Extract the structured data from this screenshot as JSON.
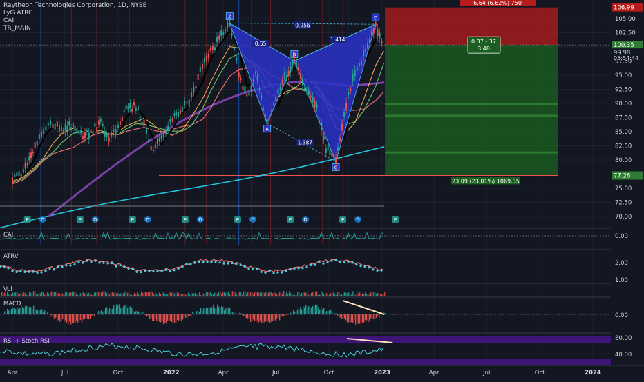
{
  "header": {
    "symbol_line": "Raytheon Technologies Corporation, 1D, NYSE",
    "indicators": [
      "LyG ATRC",
      "CAI",
      "TR_MAIN"
    ]
  },
  "panes": {
    "cai": "CAI",
    "atrv": "ATRV",
    "vol": "Vol",
    "macd": "MACD",
    "rsi": "RSI + Stoch RSI"
  },
  "colors": {
    "background": "#131722",
    "up": "#26a69a",
    "down": "#ef5350",
    "harmonic_fill": "#2a32c8",
    "ema_cyan": "#26c6da",
    "ema_purple": "#7b3fa8",
    "stop_zone": "#b71c1c",
    "target_zone": "#1b5e20"
  },
  "chart_data": {
    "type": "line",
    "title": "Raytheon Technologies Corporation, 1D, NYSE",
    "ylim": [
      68,
      107.5
    ],
    "price_axis_ticks": [
      "105.00",
      "102.50",
      "100.35",
      "97.50",
      "95.00",
      "92.50",
      "90.00",
      "87.50",
      "85.00",
      "82.50",
      "80.00",
      "77.50",
      "75.00",
      "72.50",
      "70.00"
    ],
    "time_axis_labels": [
      "Apr",
      "Jul",
      "Oct",
      "2022",
      "Apr",
      "Jul",
      "Oct",
      "2023",
      "Apr",
      "Jul",
      "Oct",
      "2024"
    ],
    "badges": {
      "top_red": "106.99",
      "entry": "100.35",
      "last": "99.98",
      "countdown": "05:54:44",
      "bottom": "77.26"
    },
    "position": {
      "entry": 100.35,
      "stop": 106.99,
      "target": 77.26,
      "stop_label": "6.64 (6.62%) 750",
      "target_label": "23.09 (23.01%) 1869.35",
      "rr_line1": "0.37 - 37",
      "rr_line2": "3.48"
    },
    "harmonic_points": [
      {
        "label": "X",
        "date": "2022-04-12",
        "price": 104.2
      },
      {
        "label": "A",
        "date": "2022-06-16",
        "price": 86.5
      },
      {
        "label": "B",
        "date": "2022-08-02",
        "price": 97.5
      },
      {
        "label": "C",
        "date": "2022-10-13",
        "price": 79.7
      },
      {
        "label": "D",
        "date": "2022-12-21",
        "price": 104.0
      }
    ],
    "harmonic_ratios": [
      "0.55",
      "1.387",
      "1.414",
      "0.956"
    ],
    "price_path": [
      [
        "2021-04-01",
        76.5
      ],
      [
        "2021-04-20",
        78
      ],
      [
        "2021-05-10",
        82.5
      ],
      [
        "2021-05-25",
        85.5
      ],
      [
        "2021-06-10",
        86.5
      ],
      [
        "2021-06-25",
        85
      ],
      [
        "2021-07-15",
        86.5
      ],
      [
        "2021-08-01",
        84
      ],
      [
        "2021-08-15",
        85
      ],
      [
        "2021-09-01",
        86.5
      ],
      [
        "2021-09-15",
        83.5
      ],
      [
        "2021-10-01",
        86
      ],
      [
        "2021-10-15",
        89
      ],
      [
        "2021-11-01",
        89.5
      ],
      [
        "2021-11-15",
        86
      ],
      [
        "2021-12-01",
        81.5
      ],
      [
        "2021-12-15",
        84
      ],
      [
        "2022-01-03",
        87
      ],
      [
        "2022-01-20",
        89.5
      ],
      [
        "2022-02-05",
        91
      ],
      [
        "2022-02-24",
        96.5
      ],
      [
        "2022-03-10",
        99
      ],
      [
        "2022-03-25",
        101.5
      ],
      [
        "2022-04-12",
        104.2
      ],
      [
        "2022-04-28",
        95.5
      ],
      [
        "2022-05-12",
        91
      ],
      [
        "2022-05-27",
        95.5
      ],
      [
        "2022-06-16",
        86.5
      ],
      [
        "2022-07-05",
        92.5
      ],
      [
        "2022-07-20",
        95
      ],
      [
        "2022-08-02",
        97.5
      ],
      [
        "2022-08-20",
        93
      ],
      [
        "2022-09-10",
        89
      ],
      [
        "2022-09-26",
        82
      ],
      [
        "2022-10-13",
        79.7
      ],
      [
        "2022-10-31",
        90
      ],
      [
        "2022-11-15",
        95.5
      ],
      [
        "2022-11-30",
        98.5
      ],
      [
        "2022-12-21",
        104
      ],
      [
        "2023-01-04",
        100
      ]
    ],
    "series": [
      {
        "values_from": "price_path"
      }
    ],
    "macd_annotation": "divergence trendline",
    "rsi_levels": [
      "80.00",
      "40.00"
    ],
    "atrv_ticks": [
      "2.00",
      "1.00"
    ],
    "cai_tick": "0.00",
    "macd_tick": "0.00"
  }
}
